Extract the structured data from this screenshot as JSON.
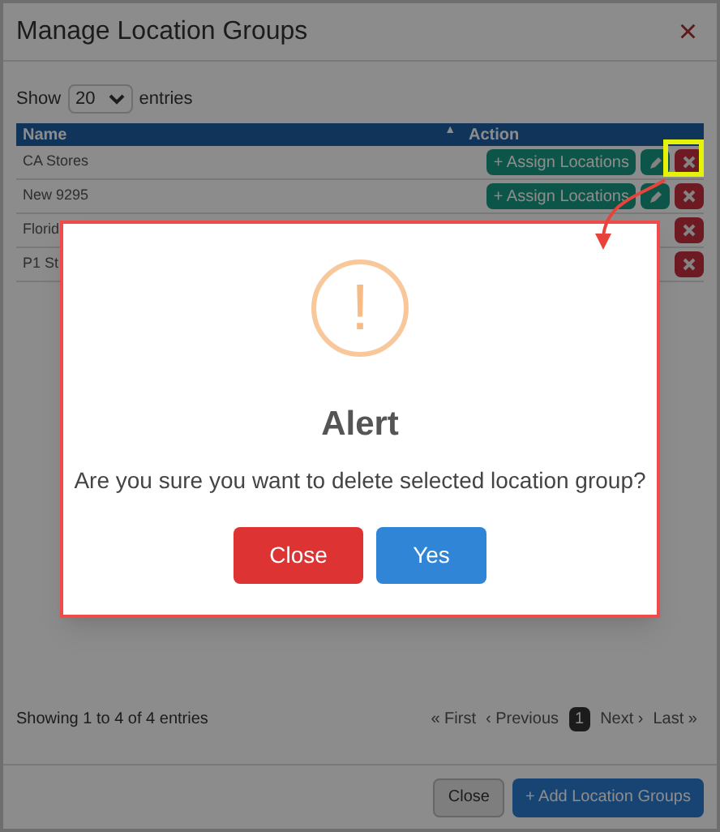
{
  "dialog": {
    "title": "Manage Location Groups",
    "close_icon": "×"
  },
  "length": {
    "before": "Show",
    "value": "20",
    "after": "entries"
  },
  "table": {
    "columns": [
      "Name",
      "Action"
    ],
    "sort_icon": "▲",
    "rows": [
      {
        "name": "CA Stores",
        "assign": "+ Assign Locations",
        "highlighted": true
      },
      {
        "name": "New 9295",
        "assign": "+ Assign Locations",
        "highlighted": false
      },
      {
        "name": "Florid",
        "highlighted": false
      },
      {
        "name": "P1 St",
        "highlighted": false
      }
    ]
  },
  "info": "Showing 1 to 4 of 4 entries",
  "pagination": [
    {
      "label": "« First",
      "selected": false
    },
    {
      "label": "‹ Previous",
      "selected": false
    },
    {
      "label": "1",
      "selected": true
    },
    {
      "label": "Next ›",
      "selected": false
    },
    {
      "label": "Last »",
      "selected": false
    }
  ],
  "footer_buttons": [
    {
      "label": "Close",
      "kind": "default"
    },
    {
      "label": "+ Add Location Groups",
      "kind": "primary"
    }
  ],
  "alert": {
    "icon": "!",
    "title": "Alert",
    "message": "Are you sure you want to delete selected location group?",
    "buttons": [
      {
        "label": "Close",
        "kind": "danger"
      },
      {
        "label": "Yes",
        "kind": "primary"
      }
    ]
  }
}
